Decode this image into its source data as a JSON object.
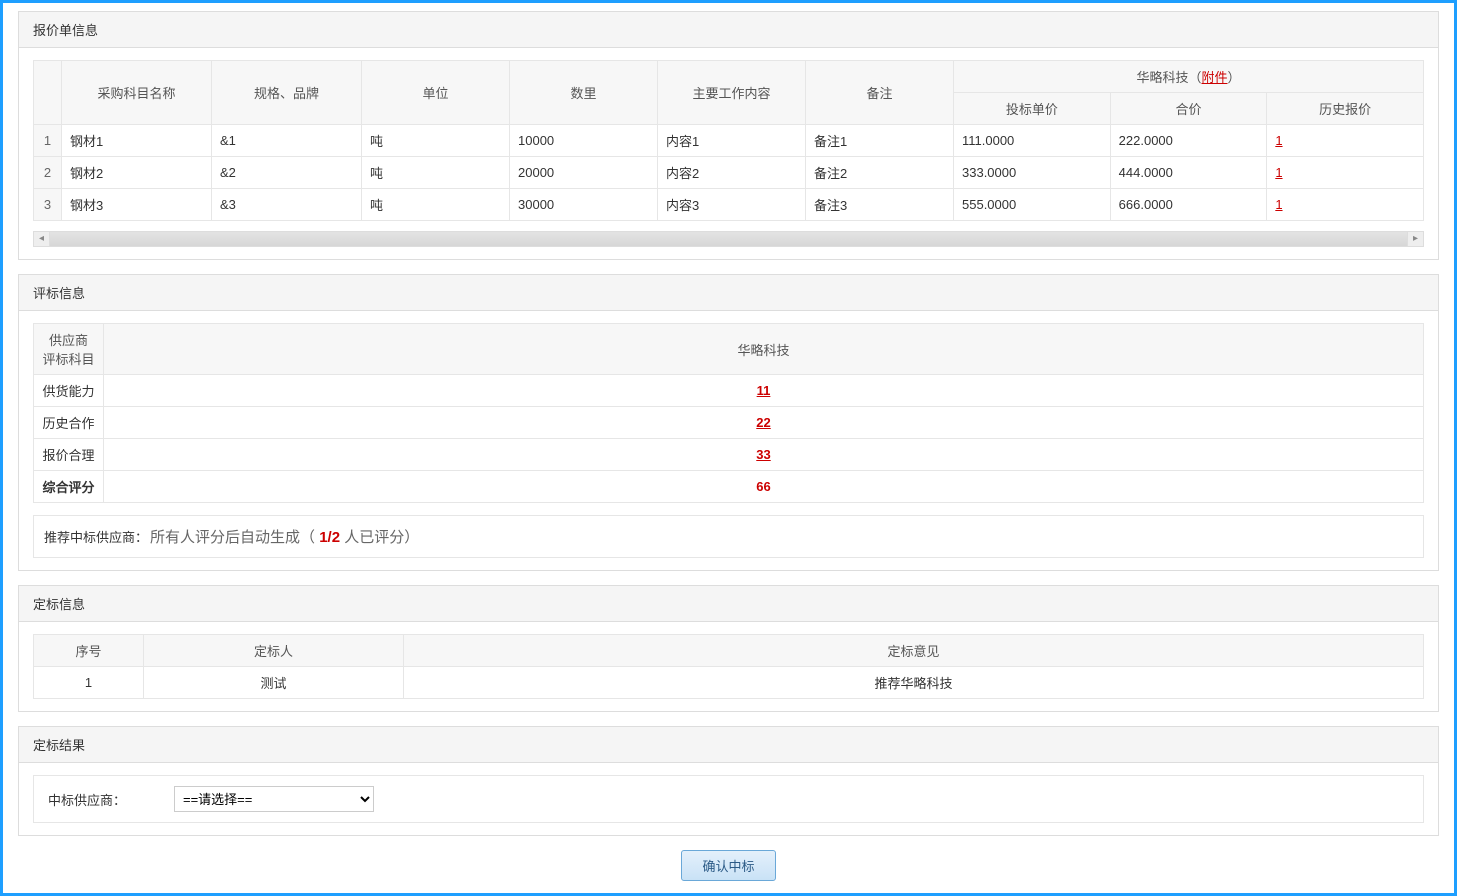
{
  "quote": {
    "panel_title": "报价单信息",
    "supplier_name": "华略科技（",
    "attachment_label": "附件",
    "supplier_name_tail": "）",
    "headers": {
      "name": "采购科目名称",
      "spec": "规格、品牌",
      "unit": "单位",
      "qty": "数里",
      "work": "主要工作内容",
      "note": "备注",
      "bid_price": "投标单价",
      "total": "合价",
      "history": "历史报价"
    },
    "rows": [
      {
        "idx": "1",
        "name": "钢材1",
        "spec": "&1",
        "unit": "吨",
        "qty": "10000",
        "work": "内容1",
        "note": "备注1",
        "bid_price": "111.0000",
        "total": "222.0000",
        "history": "1"
      },
      {
        "idx": "2",
        "name": "钢材2",
        "spec": "&2",
        "unit": "吨",
        "qty": "20000",
        "work": "内容2",
        "note": "备注2",
        "bid_price": "333.0000",
        "total": "444.0000",
        "history": "1"
      },
      {
        "idx": "3",
        "name": "钢材3",
        "spec": "&3",
        "unit": "吨",
        "qty": "30000",
        "work": "内容3",
        "note": "备注3",
        "bid_price": "555.0000",
        "total": "666.0000",
        "history": "1"
      }
    ]
  },
  "eval": {
    "panel_title": "评标信息",
    "header_left": "供应商\n评标科目",
    "header_left_line1": "供应商",
    "header_left_line2": "评标科目",
    "supplier_col": "华略科技",
    "rows": [
      {
        "label": "供货能力",
        "value": "11",
        "link": true
      },
      {
        "label": "历史合作",
        "value": "22",
        "link": true
      },
      {
        "label": "报价合理",
        "value": "33",
        "link": true
      },
      {
        "label": "综合评分",
        "value": "66",
        "link": false,
        "bold": true
      }
    ],
    "recommend_label": "推荐中标供应商：",
    "recommend_prefix": "所有人评分后自动生成（",
    "recommend_fraction": "1/2",
    "recommend_suffix": " 人已评分）"
  },
  "decision": {
    "panel_title": "定标信息",
    "headers": {
      "idx": "序号",
      "person": "定标人",
      "opinion": "定标意见"
    },
    "rows": [
      {
        "idx": "1",
        "person": "测试",
        "opinion": "推荐华略科技"
      }
    ]
  },
  "result": {
    "panel_title": "定标结果",
    "label": "中标供应商：",
    "select_placeholder": "==请选择=="
  },
  "submit_button": "确认中标"
}
